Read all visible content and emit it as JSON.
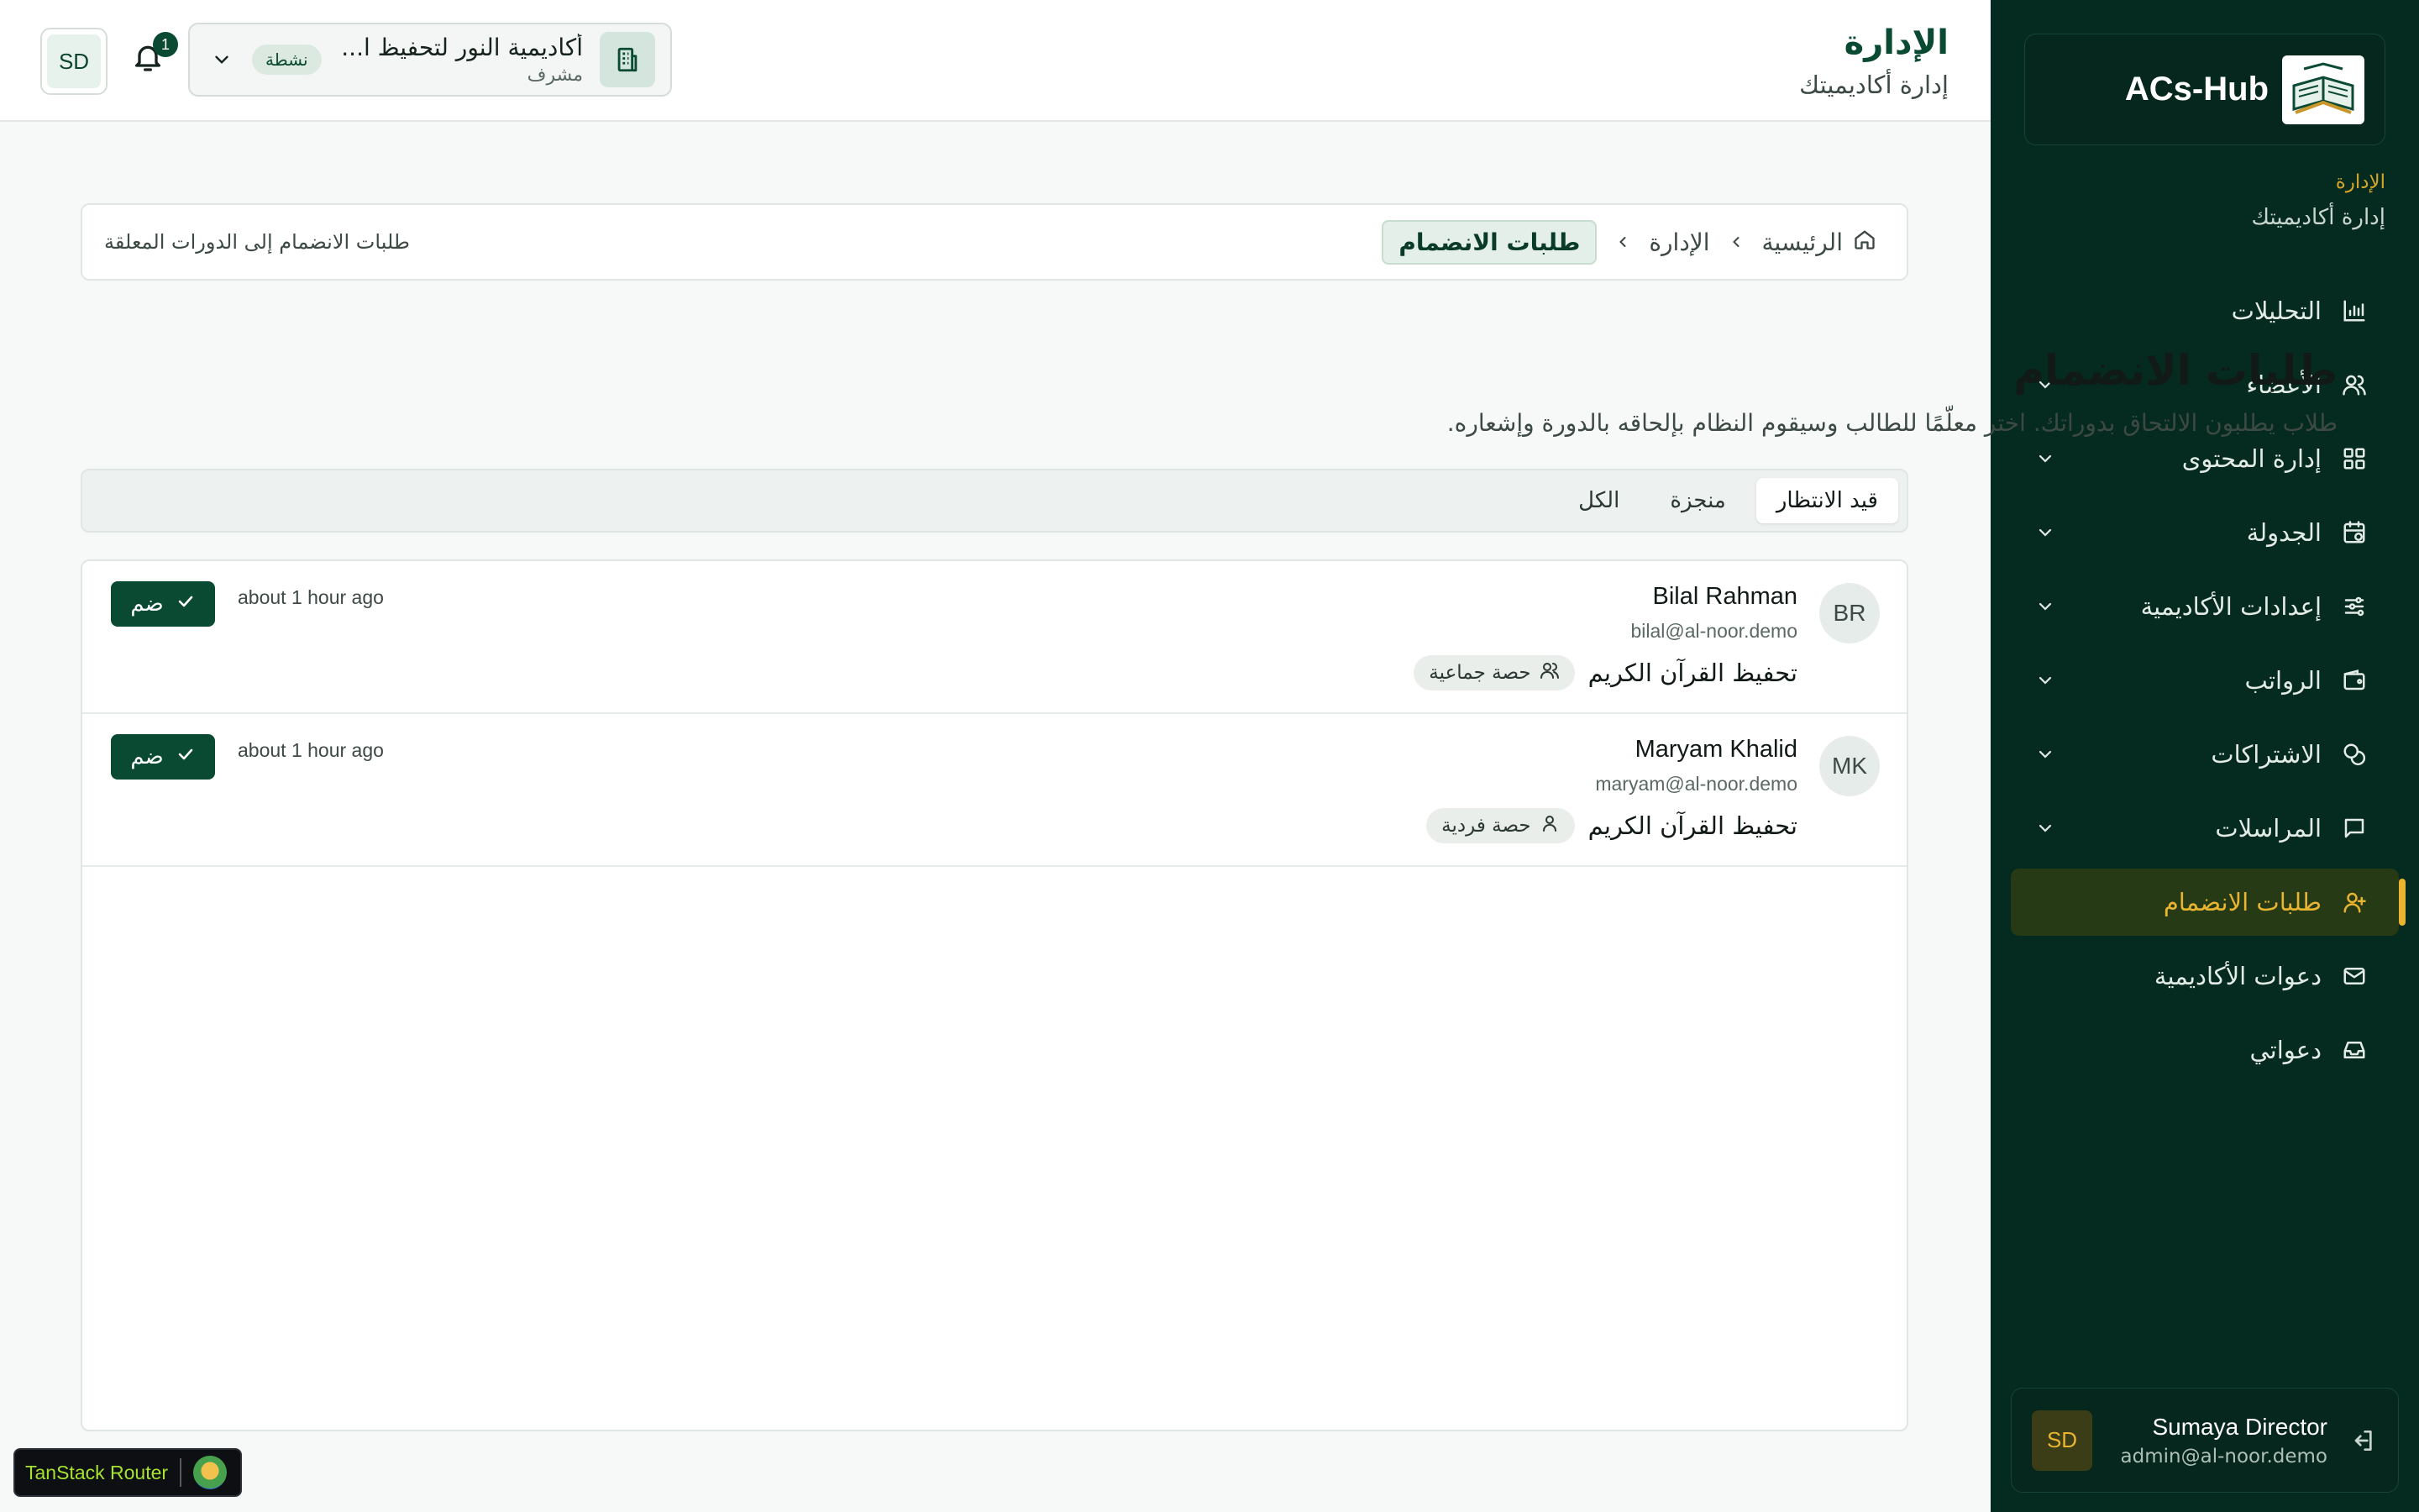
{
  "colors": {
    "sidebar_bg": "#052a1f",
    "brand_green": "#0a4a33",
    "accent_gold": "#e9b430",
    "page_bg": "#f7f9f8"
  },
  "sidebar": {
    "brand_name": "ACs-Hub",
    "context_title": "الإدارة",
    "context_subtitle": "إدارة أكاديميتك",
    "items": [
      {
        "label": "التحليلات",
        "icon": "bar-chart-icon",
        "has_chevron": false
      },
      {
        "label": "الأعضاء",
        "icon": "users-icon",
        "has_chevron": true
      },
      {
        "label": "إدارة المحتوى",
        "icon": "grid-icon",
        "has_chevron": true
      },
      {
        "label": "الجدولة",
        "icon": "calendar-clock-icon",
        "has_chevron": true
      },
      {
        "label": "إعدادات الأكاديمية",
        "icon": "sliders-icon",
        "has_chevron": true
      },
      {
        "label": "الرواتب",
        "icon": "wallet-icon",
        "has_chevron": true
      },
      {
        "label": "الاشتراكات",
        "icon": "coins-icon",
        "has_chevron": true
      },
      {
        "label": "المراسلات",
        "icon": "message-square-icon",
        "has_chevron": true
      },
      {
        "label": "طلبات الانضمام",
        "icon": "user-plus-icon",
        "has_chevron": false,
        "active": true
      },
      {
        "label": "دعوات الأكاديمية",
        "icon": "mail-icon",
        "has_chevron": false
      },
      {
        "label": "دعواتي",
        "icon": "inbox-icon",
        "has_chevron": false
      }
    ],
    "user": {
      "initials": "SD",
      "name": "Sumaya Director",
      "email": "admin@al-noor.demo"
    }
  },
  "header": {
    "title": "الإدارة",
    "subtitle": "إدارة أكاديميتك",
    "avatar_initials": "SD",
    "notification_count": "1",
    "academy": {
      "name": "أكاديمية النور لتحفيظ ا...",
      "role": "مشرف",
      "status_badge": "نشطة"
    }
  },
  "breadcrumb": {
    "home": "الرئيسية",
    "section": "الإدارة",
    "current": "طلبات الانضمام",
    "description": "طلبات الانضمام إلى الدورات المعلقة"
  },
  "page": {
    "title": "طلبات الانضمام",
    "subtitle": "طلاب يطلبون الالتحاق بدوراتك. اختر معلّمًا للطالب وسيقوم النظام بإلحاقه بالدورة وإشعاره."
  },
  "tabs": [
    {
      "label": "قيد الانتظار",
      "active": true
    },
    {
      "label": "منجزة",
      "active": false
    },
    {
      "label": "الكل",
      "active": false
    }
  ],
  "requests": [
    {
      "initials": "BR",
      "name": "Bilal Rahman",
      "email": "bilal@al-noor.demo",
      "course": "تحفيظ القرآن الكريم",
      "session_type": "حصة جماعية",
      "session_icon": "users-icon",
      "time": "about 1 hour ago",
      "action_label": "ضم"
    },
    {
      "initials": "MK",
      "name": "Maryam Khalid",
      "email": "maryam@al-noor.demo",
      "course": "تحفيظ القرآن الكريم",
      "session_type": "حصة فردية",
      "session_icon": "user-icon",
      "time": "about 1 hour ago",
      "action_label": "ضم"
    }
  ],
  "devtools": {
    "label": "TanStack Router"
  }
}
